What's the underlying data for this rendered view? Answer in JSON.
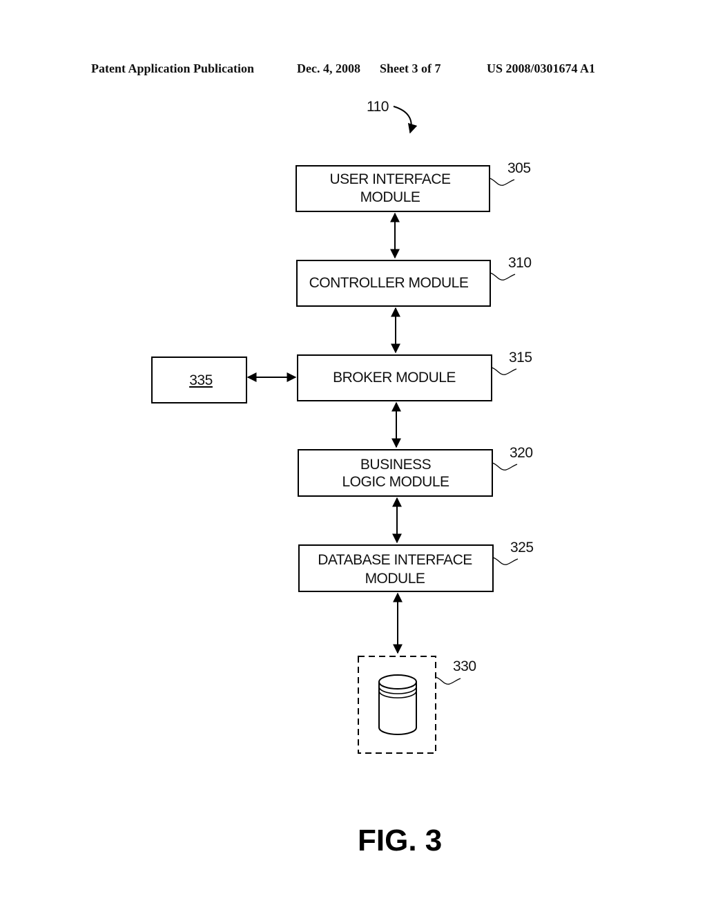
{
  "header": {
    "publication": "Patent Application Publication",
    "date": "Dec. 4, 2008",
    "sheet": "Sheet 3 of 7",
    "number": "US 2008/0301674 A1"
  },
  "diagram": {
    "system_ref": "110",
    "modules": [
      {
        "ref": "305",
        "line1": "USER INTERFACE",
        "line2": "MODULE"
      },
      {
        "ref": "310",
        "line1": "CONTROLLER MODULE",
        "line2": ""
      },
      {
        "ref": "315",
        "line1": "BROKER MODULE",
        "line2": ""
      },
      {
        "ref": "320",
        "line1": "BUSINESS",
        "line2": "LOGIC MODULE"
      },
      {
        "ref": "325",
        "line1": "DATABASE INTERFACE",
        "line2": "MODULE"
      }
    ],
    "external_box": {
      "ref": "335"
    },
    "database": {
      "ref": "330",
      "icon": "database-cylinder-icon"
    },
    "connections": [
      {
        "from": "305",
        "to": "310",
        "type": "bidirectional"
      },
      {
        "from": "310",
        "to": "315",
        "type": "bidirectional"
      },
      {
        "from": "315",
        "to": "320",
        "type": "bidirectional"
      },
      {
        "from": "320",
        "to": "325",
        "type": "bidirectional"
      },
      {
        "from": "325",
        "to": "330",
        "type": "bidirectional"
      },
      {
        "from": "335",
        "to": "315",
        "type": "bidirectional"
      }
    ]
  },
  "figure_label": "FIG. 3"
}
